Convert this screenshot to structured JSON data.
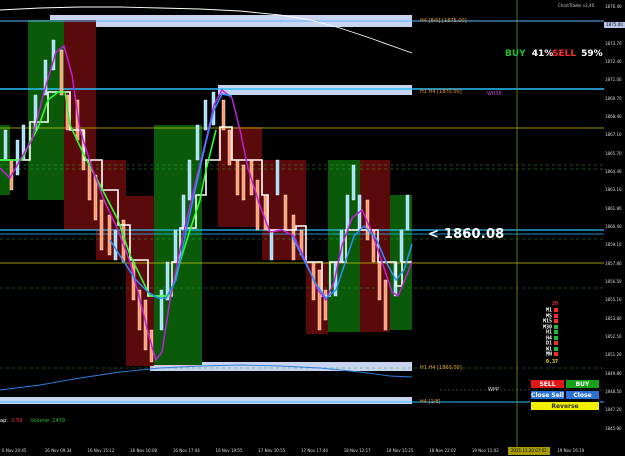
{
  "symbol_tag": "ChartTrader v2.40",
  "sentiment": {
    "buy_label": "BUY",
    "buy_value": "41%",
    "sell_label": "SELL",
    "sell_value": "59%"
  },
  "current_price_readout": "<  1860.08",
  "zones": {
    "h4_top": "H4 [8/0] [1875.00]",
    "h1_h4_mid": "H1 H4  [1870.00]",
    "wr38": "WR38",
    "h1_h4_low": "H1 H4  [1860.00]",
    "h4_bottom": "H4 [1/8]"
  },
  "timeframes": [
    "M1",
    "M5",
    "M15",
    "M30",
    "H1",
    "H4",
    "D1",
    "W1",
    "MN"
  ],
  "tf_header": "20",
  "tf_footer": "0.37",
  "tf_colors": [
    "#ff2a2a",
    "#ff2a2a",
    "#ff2a2a",
    "#1fbf2f",
    "#1fbf2f",
    "#1fbf2f",
    "#ff2a2a",
    "#1fbf2f",
    "#ff2a2a"
  ],
  "buttons": {
    "sell": "SELL",
    "buy": "BUY",
    "close_sell": "Close Sell",
    "close_buy": "Close Buy",
    "reverse": "Reverse"
  },
  "info_bar": {
    "lead": "ap:",
    "pnl": "-1.59",
    "volume_label": "Volume:",
    "volume_value": "1439"
  },
  "wpp_label": "WPP",
  "price_axis": [
    {
      "label": "1876.40",
      "hl": false
    },
    {
      "label": "1875.00",
      "hl": true,
      "color": "#b8c4e8"
    },
    {
      "label": "1873.70",
      "hl": false
    },
    {
      "label": "1872.40",
      "hl": false
    },
    {
      "label": "1871.00",
      "hl": false
    },
    {
      "label": "1869.70",
      "hl": false
    },
    {
      "label": "1868.40",
      "hl": false
    },
    {
      "label": "1867.10",
      "hl": false
    },
    {
      "label": "1865.70",
      "hl": false
    },
    {
      "label": "1864.40",
      "hl": false
    },
    {
      "label": "1863.10",
      "hl": false
    },
    {
      "label": "1861.80",
      "hl": false
    },
    {
      "label": "1860.40",
      "hl": false
    },
    {
      "label": "1859.10",
      "hl": false
    },
    {
      "label": "1857.80",
      "hl": false
    },
    {
      "label": "1856.50",
      "hl": false
    },
    {
      "label": "1855.10",
      "hl": false
    },
    {
      "label": "1853.80",
      "hl": false
    },
    {
      "label": "1852.50",
      "hl": false
    },
    {
      "label": "1851.20",
      "hl": false
    },
    {
      "label": "1849.80",
      "hl": false
    },
    {
      "label": "1848.50",
      "hl": false
    },
    {
      "label": "1847.20",
      "hl": false
    },
    {
      "label": "1845.90",
      "hl": false
    }
  ],
  "time_axis": [
    "6 Nov 20:45",
    "16 Nov 09:34",
    "16 Nov 15:12",
    "16 Nov 16:08",
    "16 Nov 17:04",
    "16 Nov 19:55",
    "17 Nov 10:55",
    "17 Nov 17:44",
    "18 Nov 12:17",
    "18 Nov 15:25",
    "18 Nov 22:02",
    "19 Nov 11:02",
    "19 Nov 16:06",
    "19 Nov 16:19"
  ],
  "cursor_date": "2021.11.20 07:02"
}
